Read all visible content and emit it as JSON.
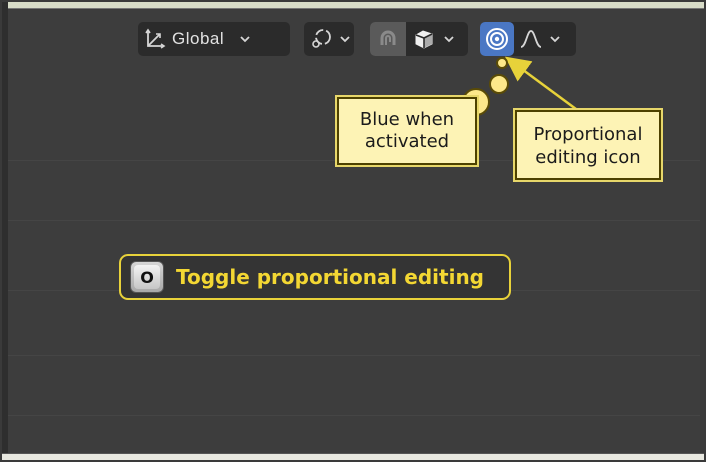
{
  "toolbar": {
    "transform_orientation": "Global",
    "icons": {
      "orientation": "orientation-axes-icon",
      "pivot": "pivot-link-icon",
      "snap_magnet": "snap-magnet-icon",
      "snap_target": "snap-cube-icon",
      "proportional": "proportional-editing-icon",
      "falloff": "falloff-curve-icon"
    }
  },
  "callouts": {
    "blue_when_activated": "Blue when activated",
    "proportional_editing_icon": "Proportional editing icon"
  },
  "shortcut": {
    "key": "O",
    "label": "Toggle proportional editing"
  },
  "colors": {
    "viewport_bg": "#3d3d3d",
    "toolbar_bg": "#2b2b2b",
    "active_blue": "#4a77c4",
    "callout_bg": "#fdf3b5",
    "shortcut_text": "#f3d733"
  }
}
